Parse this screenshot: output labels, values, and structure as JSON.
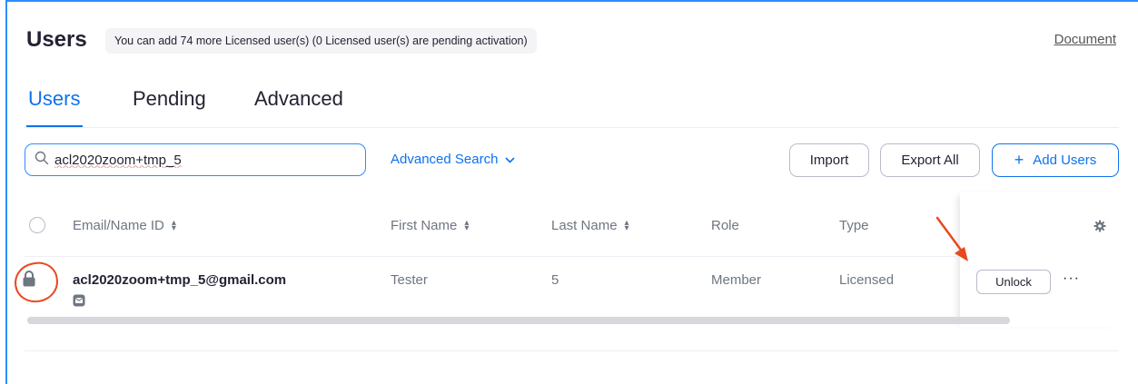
{
  "header": {
    "title": "Users",
    "license_banner": "You can add 74 more Licensed user(s) (0 Licensed user(s) are pending activation)",
    "doc_link": "Document"
  },
  "tabs": [
    {
      "label": "Users",
      "active": true
    },
    {
      "label": "Pending",
      "active": false
    },
    {
      "label": "Advanced",
      "active": false
    }
  ],
  "toolbar": {
    "search_value": "acl2020zoom+tmp_5",
    "advanced_search_label": "Advanced Search",
    "import_label": "Import",
    "export_label": "Export All",
    "add_users_label": "Add Users"
  },
  "table": {
    "columns": [
      "Email/Name ID",
      "First Name",
      "Last Name",
      "Role",
      "Type"
    ],
    "rows": [
      {
        "email": "acl2020zoom+tmp_5@gmail.com",
        "first_name": "Tester",
        "last_name": "5",
        "role": "Member",
        "type": "Licensed",
        "action_label": "Unlock",
        "locked": true
      }
    ]
  },
  "colors": {
    "accent": "#0e72ed",
    "annotation": "#e8491d"
  },
  "icons": [
    "search-icon",
    "chevron-down-icon",
    "plus-icon",
    "sort-icon",
    "gear-icon",
    "lock-icon",
    "mail-icon",
    "more-icon"
  ]
}
